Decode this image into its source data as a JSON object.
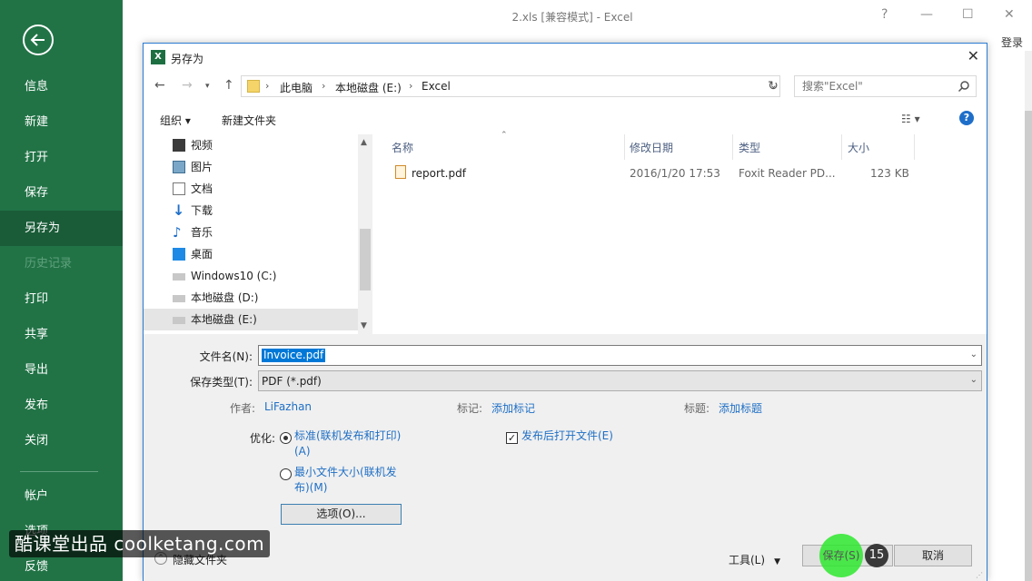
{
  "window": {
    "title": "2.xls  [兼容模式] - Excel",
    "help": "?",
    "login": "登录"
  },
  "backstage": {
    "items": [
      {
        "label": "信息"
      },
      {
        "label": "新建"
      },
      {
        "label": "打开"
      },
      {
        "label": "保存"
      },
      {
        "label": "另存为",
        "active": true
      },
      {
        "label": "历史记录",
        "disabled": true
      },
      {
        "label": "打印"
      },
      {
        "label": "共享"
      },
      {
        "label": "导出"
      },
      {
        "label": "发布"
      },
      {
        "label": "关闭"
      },
      {
        "label": "帐户"
      },
      {
        "label": "选项"
      },
      {
        "label": "反馈"
      }
    ]
  },
  "dialog": {
    "title": "另存为",
    "close": "✕",
    "breadcrumb": [
      "此电脑",
      "本地磁盘 (E:)",
      "Excel"
    ],
    "search_placeholder": "搜索\"Excel\"",
    "organize": "组织 ▾",
    "new_folder": "新建文件夹",
    "nav_items": [
      {
        "label": "视频",
        "icon": "video-icon"
      },
      {
        "label": "图片",
        "icon": "pictures-icon"
      },
      {
        "label": "文档",
        "icon": "documents-icon"
      },
      {
        "label": "下载",
        "icon": "download-icon"
      },
      {
        "label": "音乐",
        "icon": "music-icon"
      },
      {
        "label": "桌面",
        "icon": "desktop-icon"
      },
      {
        "label": "Windows10 (C:)",
        "icon": "drive-icon"
      },
      {
        "label": "本地磁盘 (D:)",
        "icon": "drive-icon"
      },
      {
        "label": "本地磁盘 (E:)",
        "icon": "drive-icon",
        "selected": true
      }
    ],
    "columns": [
      "名称",
      "修改日期",
      "类型",
      "大小"
    ],
    "files": [
      {
        "name": "report.pdf",
        "date": "2016/1/20 17:53",
        "type": "Foxit Reader PD...",
        "size": "123 KB"
      }
    ],
    "form": {
      "filename_label": "文件名(N):",
      "filename_value": "Invoice.pdf",
      "filetype_label": "保存类型(T):",
      "filetype_value": "PDF (*.pdf)",
      "author_label": "作者:",
      "author_value": "LiFazhan",
      "tags_label": "标记:",
      "tags_value": "添加标记",
      "title_label": "标题:",
      "title_value": "添加标题",
      "optimize_label": "优化:",
      "opt_standard_line1": "标准(联机发布和打印)",
      "opt_standard_line2": "(A)",
      "opt_min_line1": "最小文件大小(联机发",
      "opt_min_line2": "布)(M)",
      "open_after_publish": "发布后打开文件(E)",
      "options_button": "选项(O)...",
      "hide_folders": "隐藏文件夹",
      "tools": "工具(L)",
      "save": "保存(S)",
      "cancel": "取消",
      "step_badge": "15"
    }
  },
  "watermark": "酷课堂出品 coolketang.com"
}
